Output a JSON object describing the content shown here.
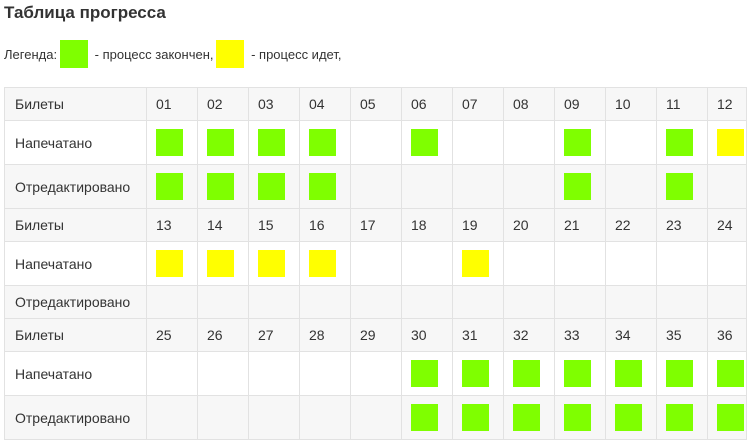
{
  "title": "Таблица прогресса",
  "legend": {
    "prefix": "Легенда:",
    "done_text": " - процесс закончен,",
    "progress_text": " - процесс идет,",
    "done_color": "#7fff00",
    "progress_color": "#ffff00"
  },
  "labels": {
    "tickets": "Билеты",
    "printed": "Напечатано",
    "edited": "Отредактировано"
  },
  "blocks": [
    {
      "tickets": [
        "01",
        "02",
        "03",
        "04",
        "05",
        "06",
        "07",
        "08",
        "09",
        "10",
        "11",
        "12"
      ],
      "printed": [
        "done",
        "done",
        "done",
        "done",
        "",
        "done",
        "",
        "",
        "done",
        "",
        "done",
        "progress"
      ],
      "edited": [
        "done",
        "done",
        "done",
        "done",
        "",
        "",
        "",
        "",
        "done",
        "",
        "done",
        ""
      ]
    },
    {
      "tickets": [
        "13",
        "14",
        "15",
        "16",
        "17",
        "18",
        "19",
        "20",
        "21",
        "22",
        "23",
        "24"
      ],
      "printed": [
        "progress",
        "progress",
        "progress",
        "progress",
        "",
        "",
        "progress",
        "",
        "",
        "",
        "",
        ""
      ],
      "edited": [
        "",
        "",
        "",
        "",
        "",
        "",
        "",
        "",
        "",
        "",
        "",
        ""
      ]
    },
    {
      "tickets": [
        "25",
        "26",
        "27",
        "28",
        "29",
        "30",
        "31",
        "32",
        "33",
        "34",
        "35",
        "36"
      ],
      "printed": [
        "",
        "",
        "",
        "",
        "",
        "done",
        "done",
        "done",
        "done",
        "done",
        "done",
        "done"
      ],
      "edited": [
        "",
        "",
        "",
        "",
        "",
        "done",
        "done",
        "done",
        "done",
        "done",
        "done",
        "done"
      ]
    }
  ]
}
